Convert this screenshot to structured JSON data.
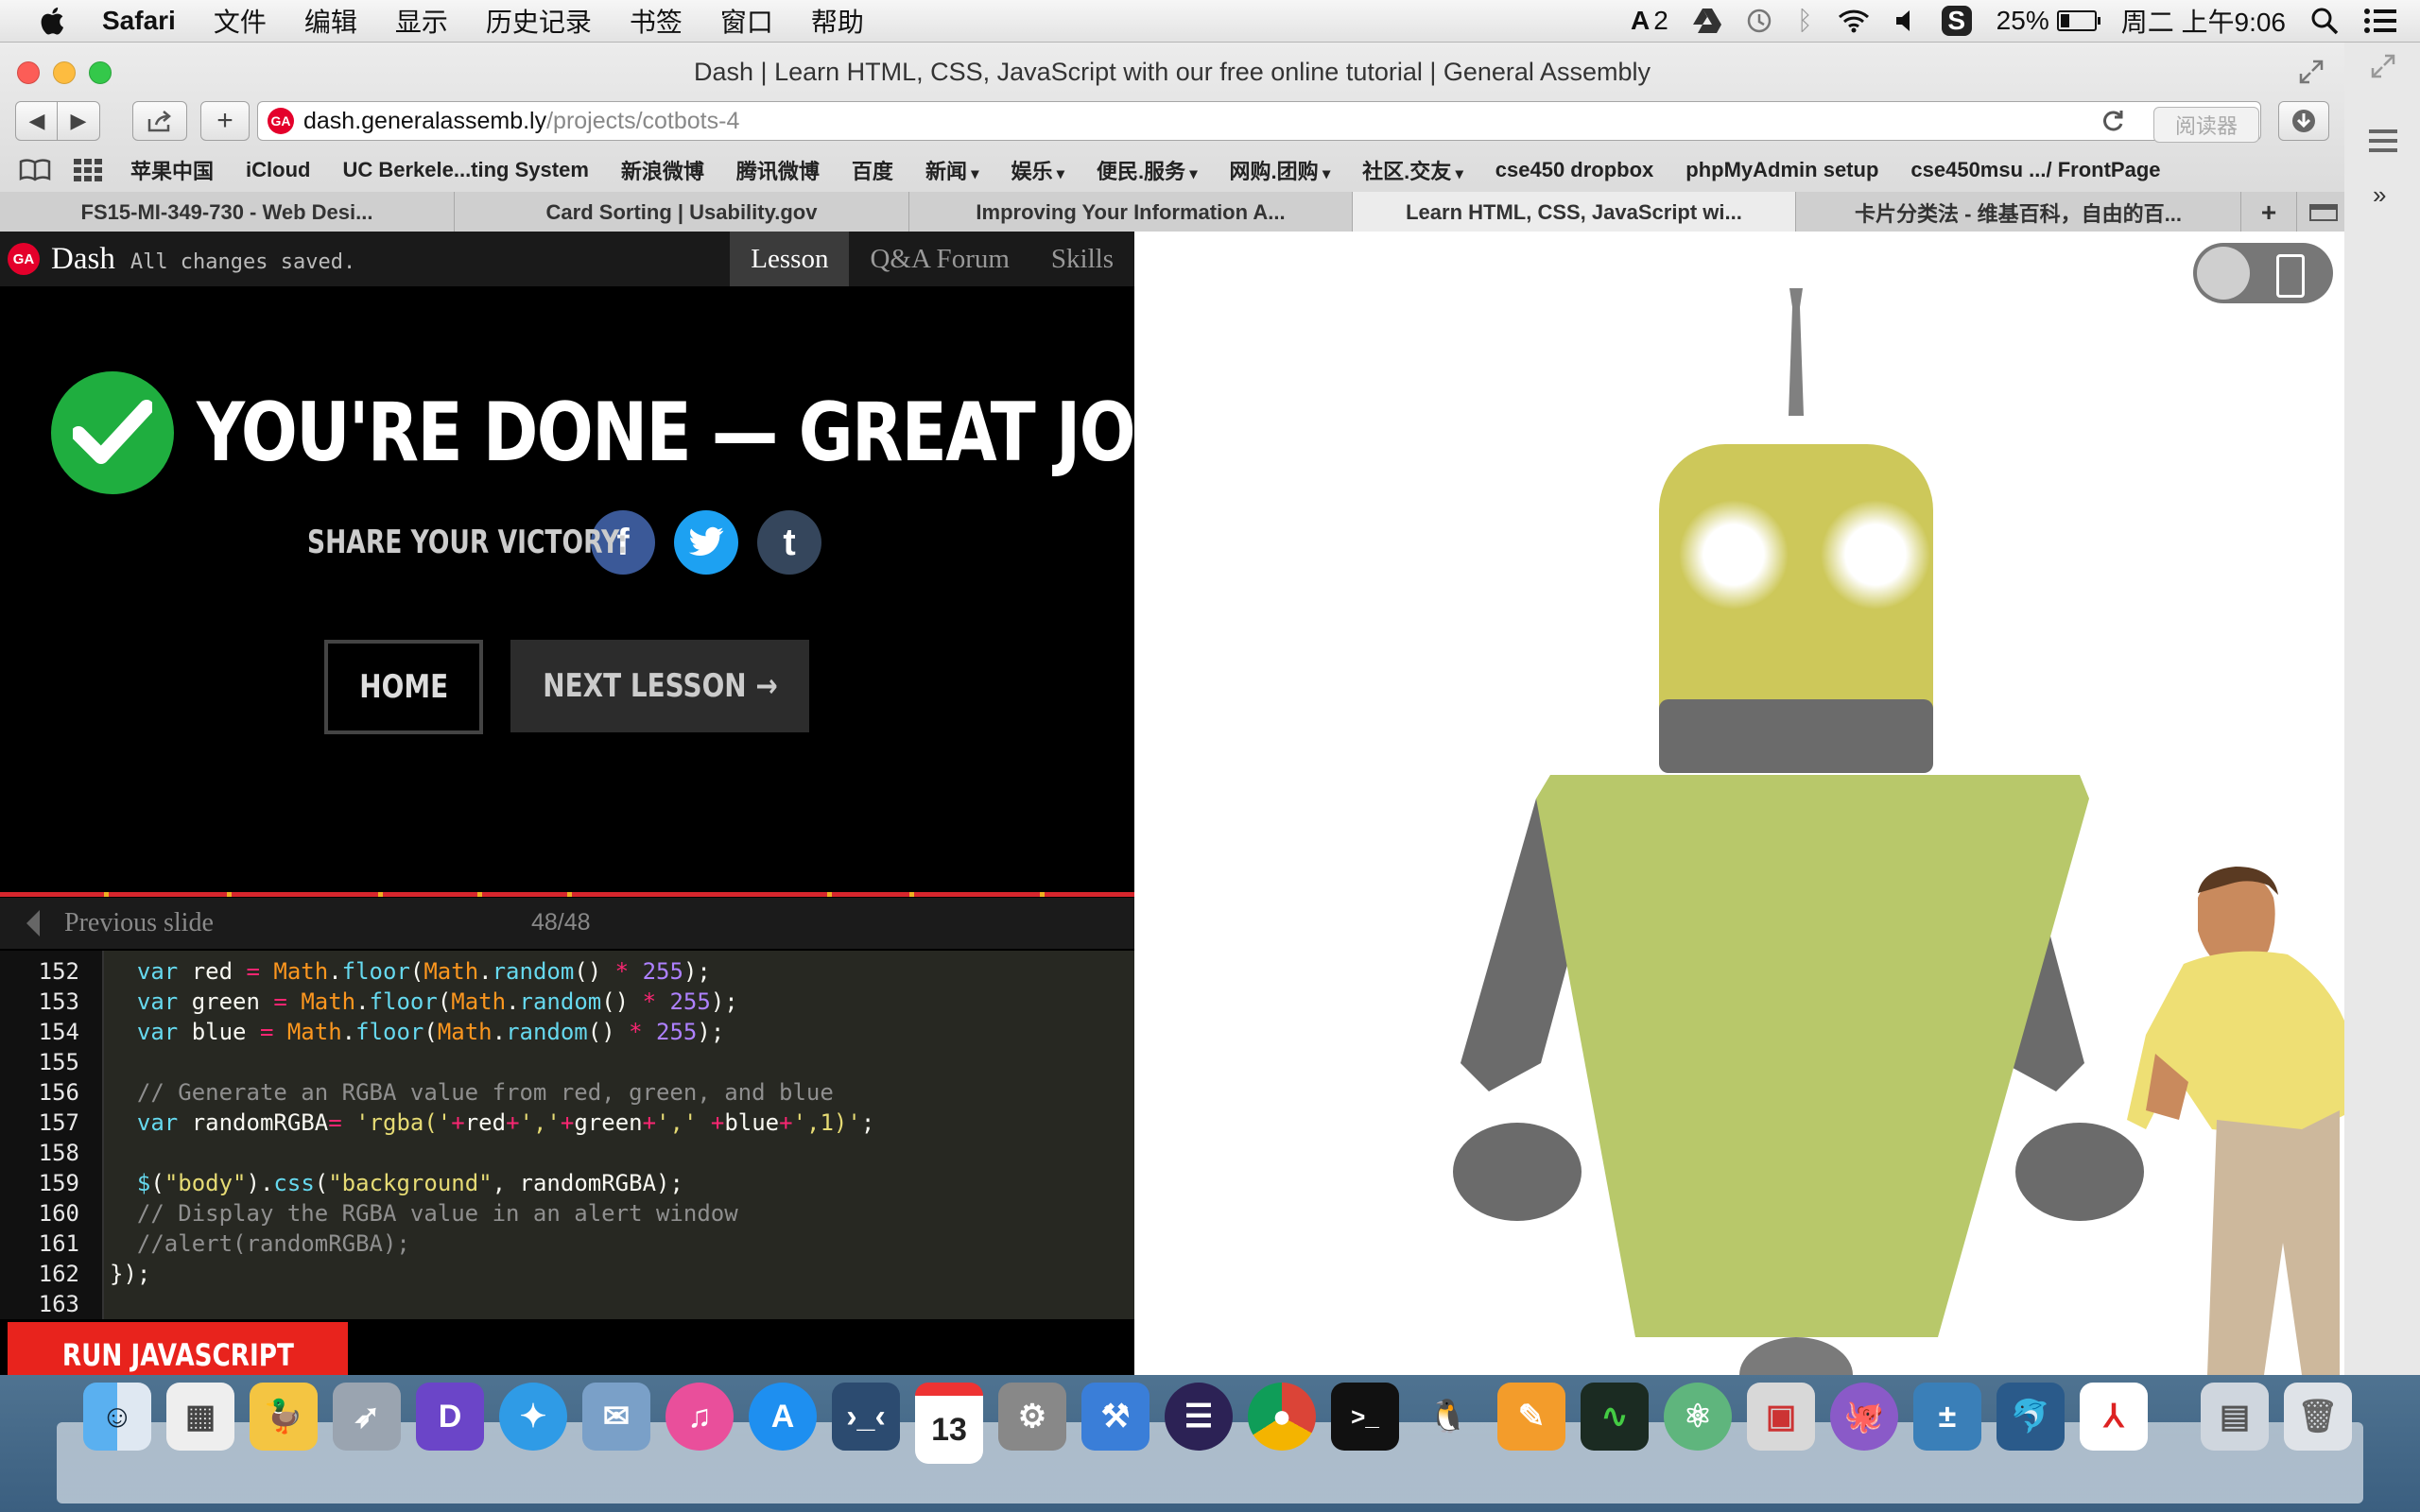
{
  "menubar": {
    "app_name": "Safari",
    "menus": [
      "文件",
      "编辑",
      "显示",
      "历史记录",
      "书签",
      "窗口",
      "帮助"
    ],
    "status": {
      "adobe_count": "2",
      "battery": "25%",
      "clock": "周二 上午9:06"
    }
  },
  "window": {
    "title": "Dash | Learn HTML, CSS, JavaScript with our free online tutorial | General Assembly",
    "address": {
      "host": "dash.generalassemb.ly",
      "path": "/projects/cotbots-4"
    },
    "reader_label": "阅读器",
    "bookmarks": [
      {
        "label": "苹果中国",
        "caret": false
      },
      {
        "label": "iCloud",
        "caret": false
      },
      {
        "label": "UC Berkele...ting System",
        "caret": false
      },
      {
        "label": "新浪微博",
        "caret": false
      },
      {
        "label": "腾讯微博",
        "caret": false
      },
      {
        "label": "百度",
        "caret": false
      },
      {
        "label": "新闻",
        "caret": true
      },
      {
        "label": "娱乐",
        "caret": true
      },
      {
        "label": "便民.服务",
        "caret": true
      },
      {
        "label": "网购.团购",
        "caret": true
      },
      {
        "label": "社区.交友",
        "caret": true
      },
      {
        "label": "cse450 dropbox",
        "caret": false
      },
      {
        "label": "phpMyAdmin setup",
        "caret": false
      },
      {
        "label": "cse450msu .../ FrontPage",
        "caret": false
      }
    ],
    "tabs": [
      {
        "label": "FS15-MI-349-730 - Web Desi...",
        "active": false
      },
      {
        "label": "Card Sorting | Usability.gov",
        "active": false
      },
      {
        "label": "Improving Your Information A...",
        "active": false
      },
      {
        "label": "Learn HTML, CSS, JavaScript wi...",
        "active": true
      },
      {
        "label": "卡片分类法 - 维基百科，自由的百...",
        "active": false
      }
    ]
  },
  "dash": {
    "logo_text": "GA",
    "brand": "Dash",
    "save_status": "All changes saved.",
    "nav": [
      {
        "label": "Lesson",
        "active": true
      },
      {
        "label": "Q&A Forum",
        "active": false
      },
      {
        "label": "Skills",
        "active": false
      }
    ],
    "done_heading": "YOU'RE DONE — GREAT JOB!",
    "share_label": "SHARE YOUR VICTORY:",
    "share_icons": [
      "facebook-icon",
      "twitter-icon",
      "tumblr-icon"
    ],
    "home_label": "HOME",
    "next_lesson_label": "NEXT LESSON →",
    "prev_slide_label": "Previous slide",
    "slide_count": "48/48",
    "run_label": "RUN JAVASCRIPT",
    "colors": {
      "accent_red": "#e8231d",
      "check_green": "#1fae3f",
      "facebook": "#3b5998",
      "twitter": "#1da1f2",
      "tumblr": "#35465c"
    }
  },
  "code": {
    "lines": [
      {
        "n": "152",
        "text": "  var red = Math.floor(Math.random() * 255);"
      },
      {
        "n": "153",
        "text": "  var green = Math.floor(Math.random() * 255);"
      },
      {
        "n": "154",
        "text": "  var blue = Math.floor(Math.random() * 255);"
      },
      {
        "n": "155",
        "text": ""
      },
      {
        "n": "156",
        "text": "  // Generate an RGBA value from red, green, and blue"
      },
      {
        "n": "157",
        "text": "  var randomRGBA= 'rgba('+red+','+green+',' +blue+',1)';"
      },
      {
        "n": "158",
        "text": ""
      },
      {
        "n": "159",
        "text": "  $(\"body\").css(\"background\", randomRGBA);"
      },
      {
        "n": "160",
        "text": "  // Display the RGBA value in an alert window"
      },
      {
        "n": "161",
        "text": "  //alert(randomRGBA);"
      },
      {
        "n": "162",
        "text": "});"
      },
      {
        "n": "163",
        "text": ""
      }
    ]
  },
  "preview": {
    "robot_colors": {
      "head": "#cdc85a",
      "body": "#b8c86a",
      "limbs": "#6b6b6b",
      "antenna": "#808080"
    }
  },
  "dock": {
    "apps": [
      "finder-icon",
      "launchpad-icon",
      "cyberduck-icon",
      "rocket-icon",
      "dash-docs-icon",
      "safari-icon",
      "mail-icon",
      "itunes-icon",
      "app-store-icon",
      "remote-desktop-icon",
      "calendar-icon",
      "system-preferences-icon",
      "xcode-icon",
      "eclipse-icon",
      "chrome-icon",
      "terminal-icon",
      "qq-icon",
      "pages-icon",
      "activity-monitor-icon",
      "atom-icon",
      "chrome-apps-icon",
      "github-icon",
      "calculator-icon",
      "mysql-workbench-icon",
      "acrobat-icon",
      "documents-folder-icon",
      "trash-icon"
    ],
    "calendar_day": "13"
  }
}
